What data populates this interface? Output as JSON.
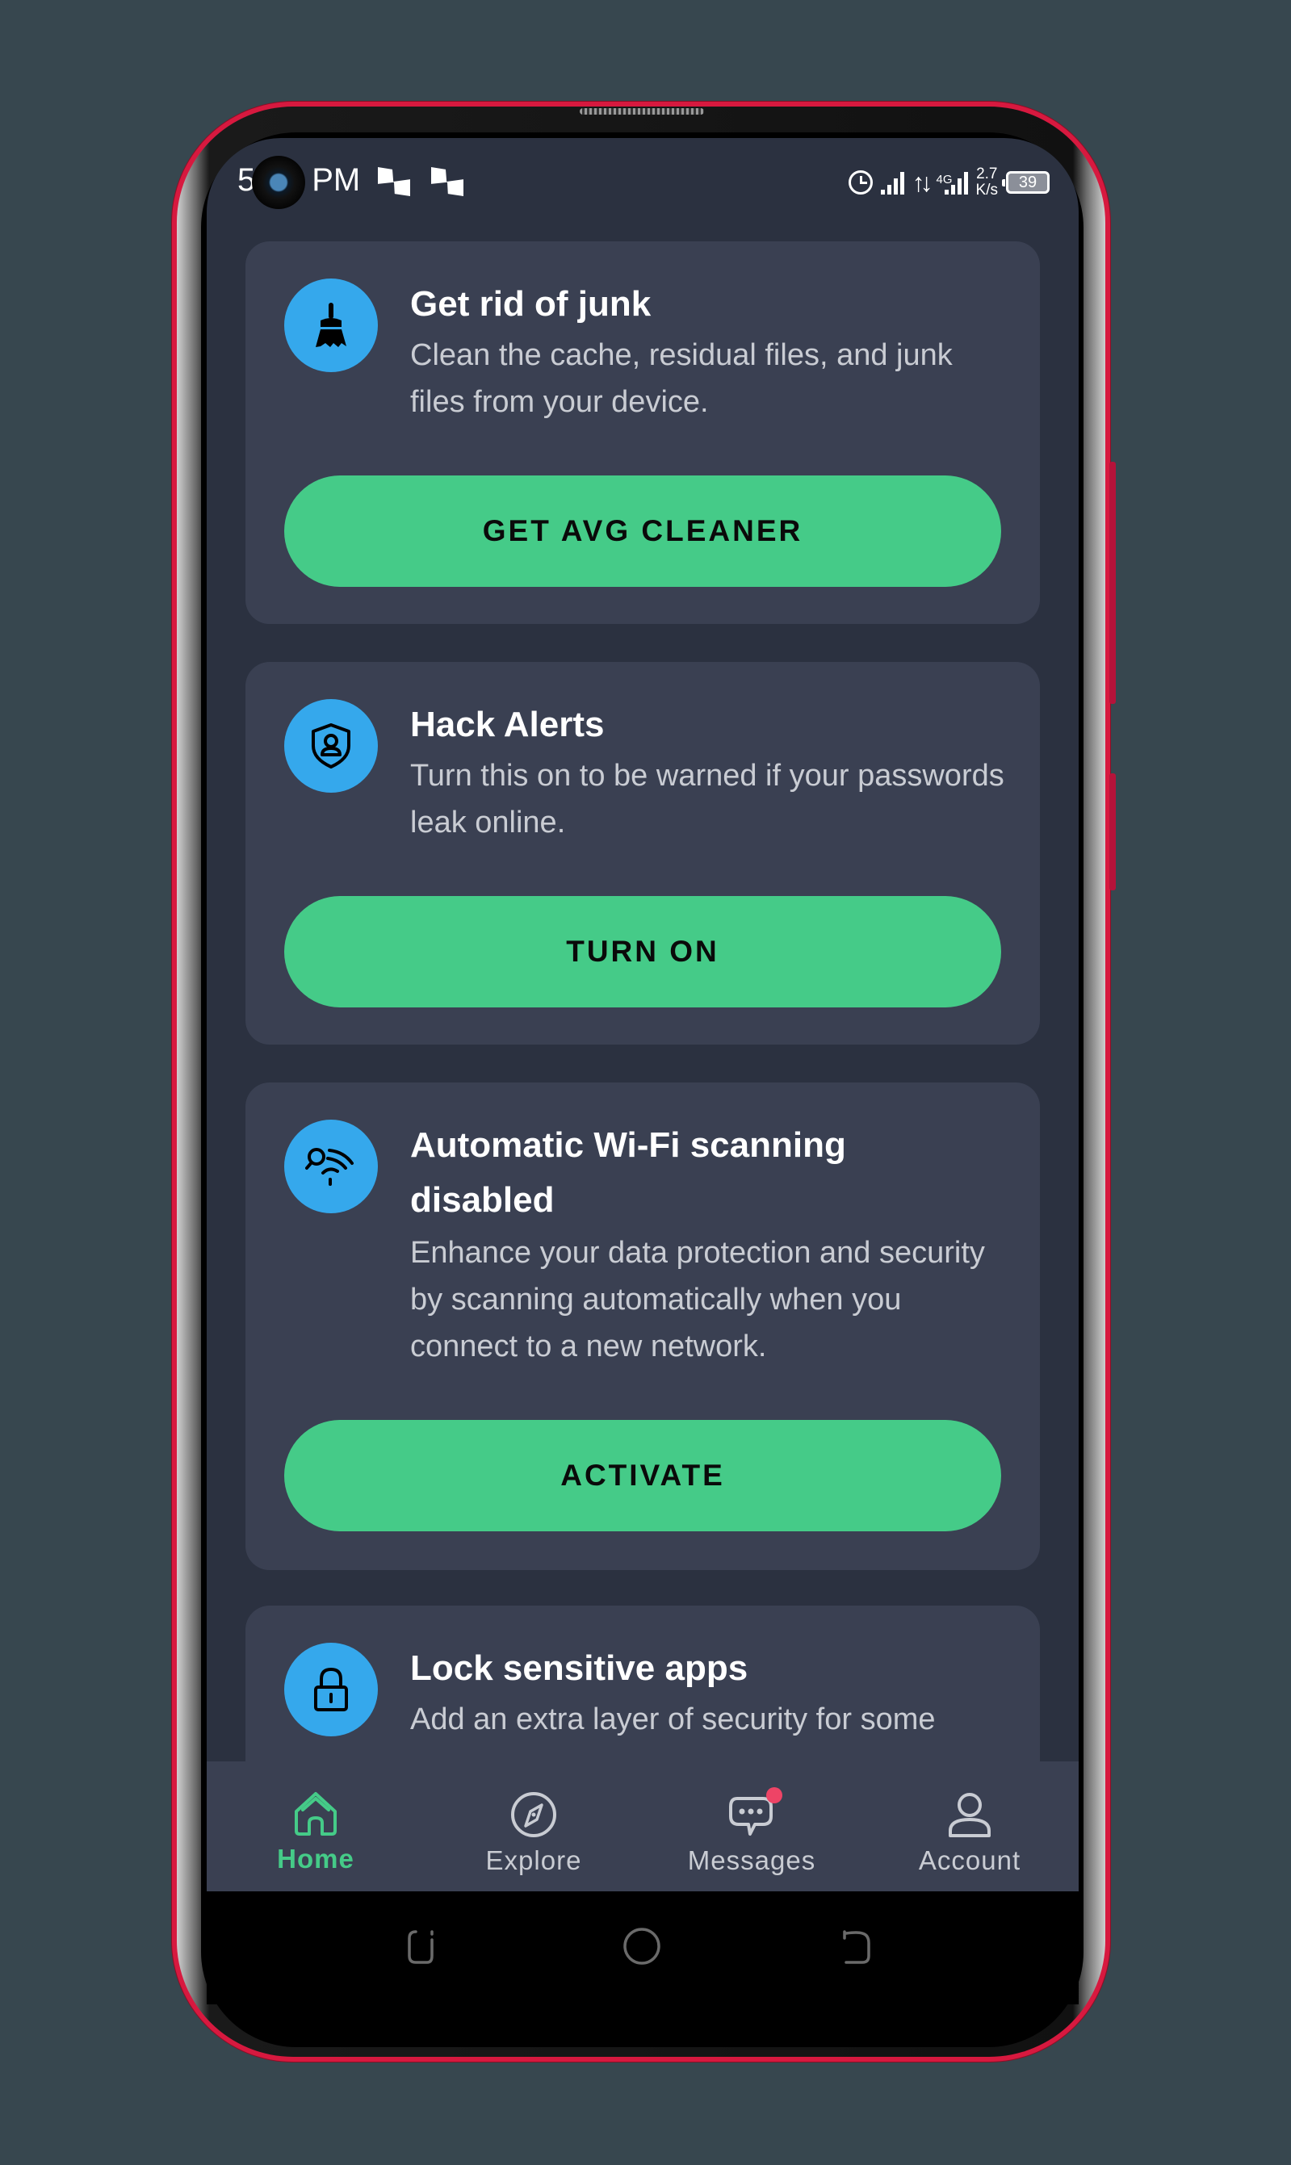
{
  "status_bar": {
    "time_hour": "5",
    "time_suffix": "PM",
    "network_speed_value": "2.7",
    "network_speed_unit": "K/s",
    "network_type": "4G",
    "battery_level": "39",
    "icons": [
      "notification-icon",
      "notification-icon",
      "alarm-icon",
      "signal-icon",
      "data-transfer-icon",
      "signal-4g-icon",
      "battery-icon"
    ]
  },
  "cards": [
    {
      "icon": "broom-icon",
      "title": "Get rid of junk",
      "description": "Clean the cache, residual files, and junk files from your device.",
      "button_label": "GET AVG CLEANER"
    },
    {
      "icon": "shield-user-icon",
      "title": "Hack Alerts",
      "description": "Turn this on to be warned if your passwords leak online.",
      "button_label": "TURN ON"
    },
    {
      "icon": "wifi-scan-icon",
      "title": "Automatic Wi-Fi scanning disabled",
      "description": "Enhance your data protection and security by scanning automatically when you connect to a new network.",
      "button_label": "ACTIVATE"
    },
    {
      "icon": "lock-icon",
      "title": "Lock sensitive apps",
      "description": "Add an extra layer of security for some"
    }
  ],
  "bottom_nav": {
    "items": [
      {
        "label": "Home",
        "icon": "home-icon",
        "active": true
      },
      {
        "label": "Explore",
        "icon": "compass-icon",
        "active": false
      },
      {
        "label": "Messages",
        "icon": "messages-icon",
        "active": false,
        "has_badge": true
      },
      {
        "label": "Account",
        "icon": "account-icon",
        "active": false
      }
    ]
  },
  "colors": {
    "accent_green": "#45cb88",
    "icon_blue": "#35a8ec",
    "card_bg": "#3a4052",
    "screen_bg": "#2b3140",
    "badge_red": "#ee4466",
    "frame_red": "#d7193f"
  }
}
